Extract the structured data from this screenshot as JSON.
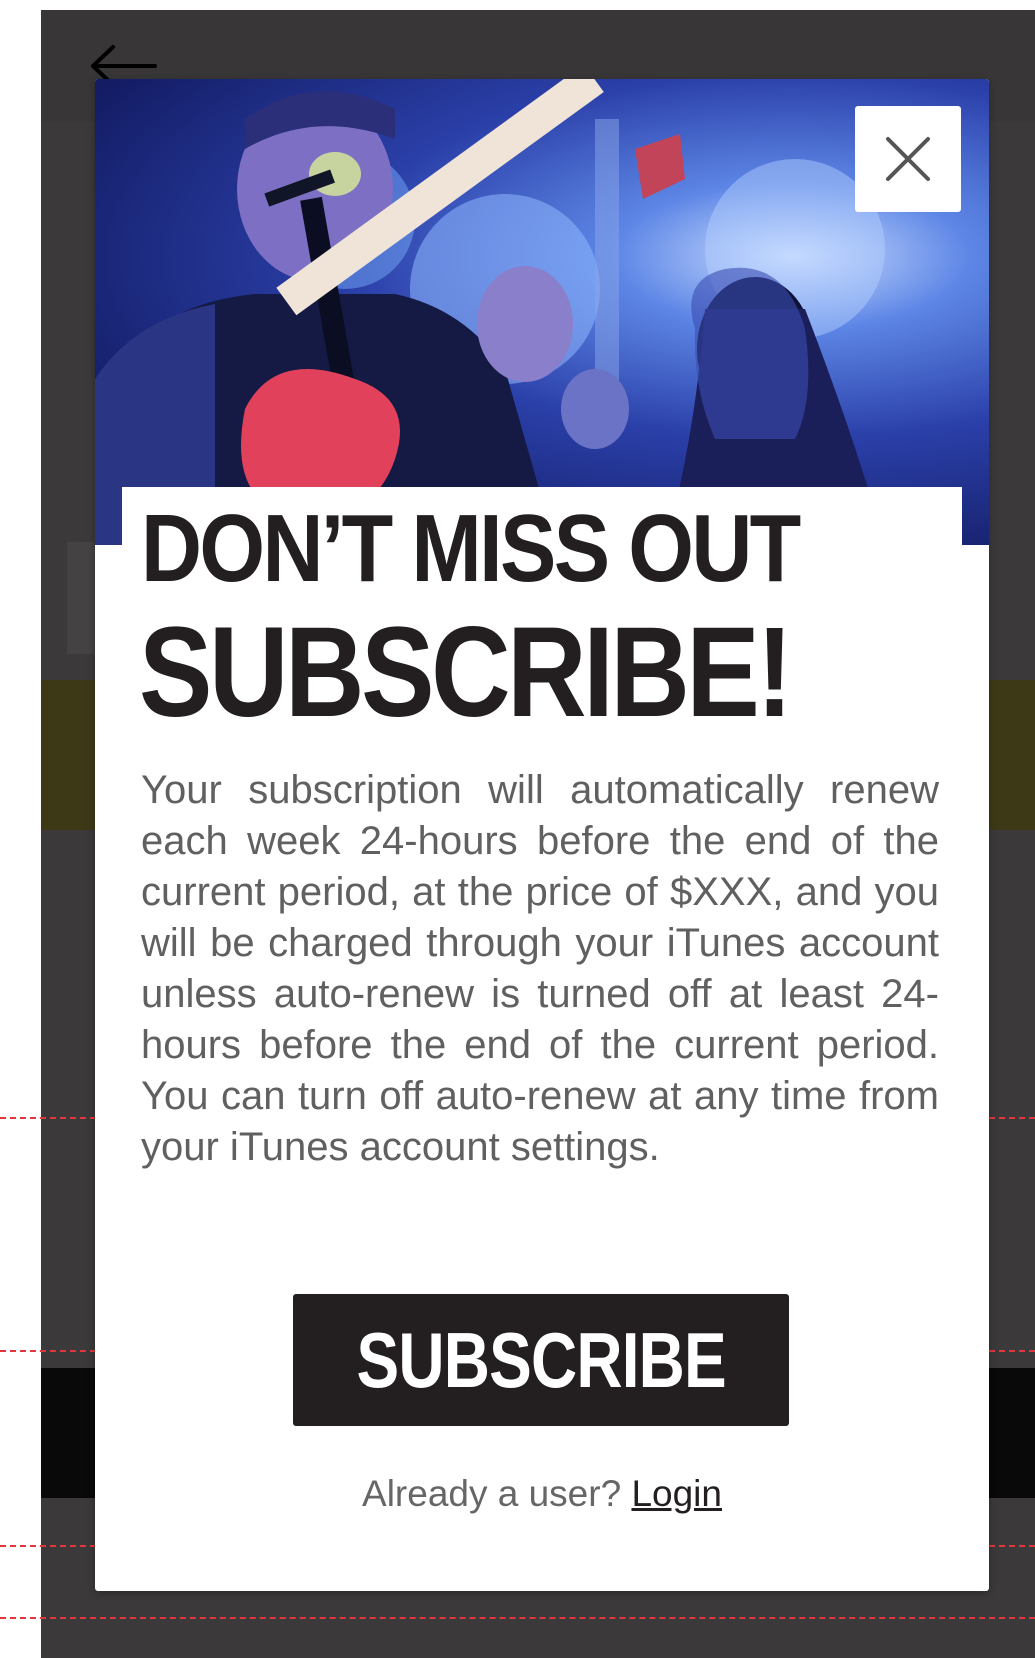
{
  "background": {
    "back_icon": "arrow-left-icon"
  },
  "modal": {
    "close_icon": "close-icon",
    "hero_image": "concert-guitarist-photo",
    "headline": "DON’T MISS OUT",
    "title": "SUBSCRIBE!",
    "body": "Your subscription will automatically renew each week 24-hours before the end of the current period, at the price of $XXX, and you will be charged through your iTunes account unless auto-renew is turned off at least 24-hours before the end of the current period. You can turn off auto-renew at any time from your iTunes account settings.",
    "subscribe_label": "SUBSCRIBE",
    "login_prompt": "Already a user?",
    "login_label": "Login"
  },
  "colors": {
    "primary_dark": "#231f20",
    "body_text": "#606060",
    "overlay": "#3b393a",
    "guide_line": "#e2363a"
  }
}
